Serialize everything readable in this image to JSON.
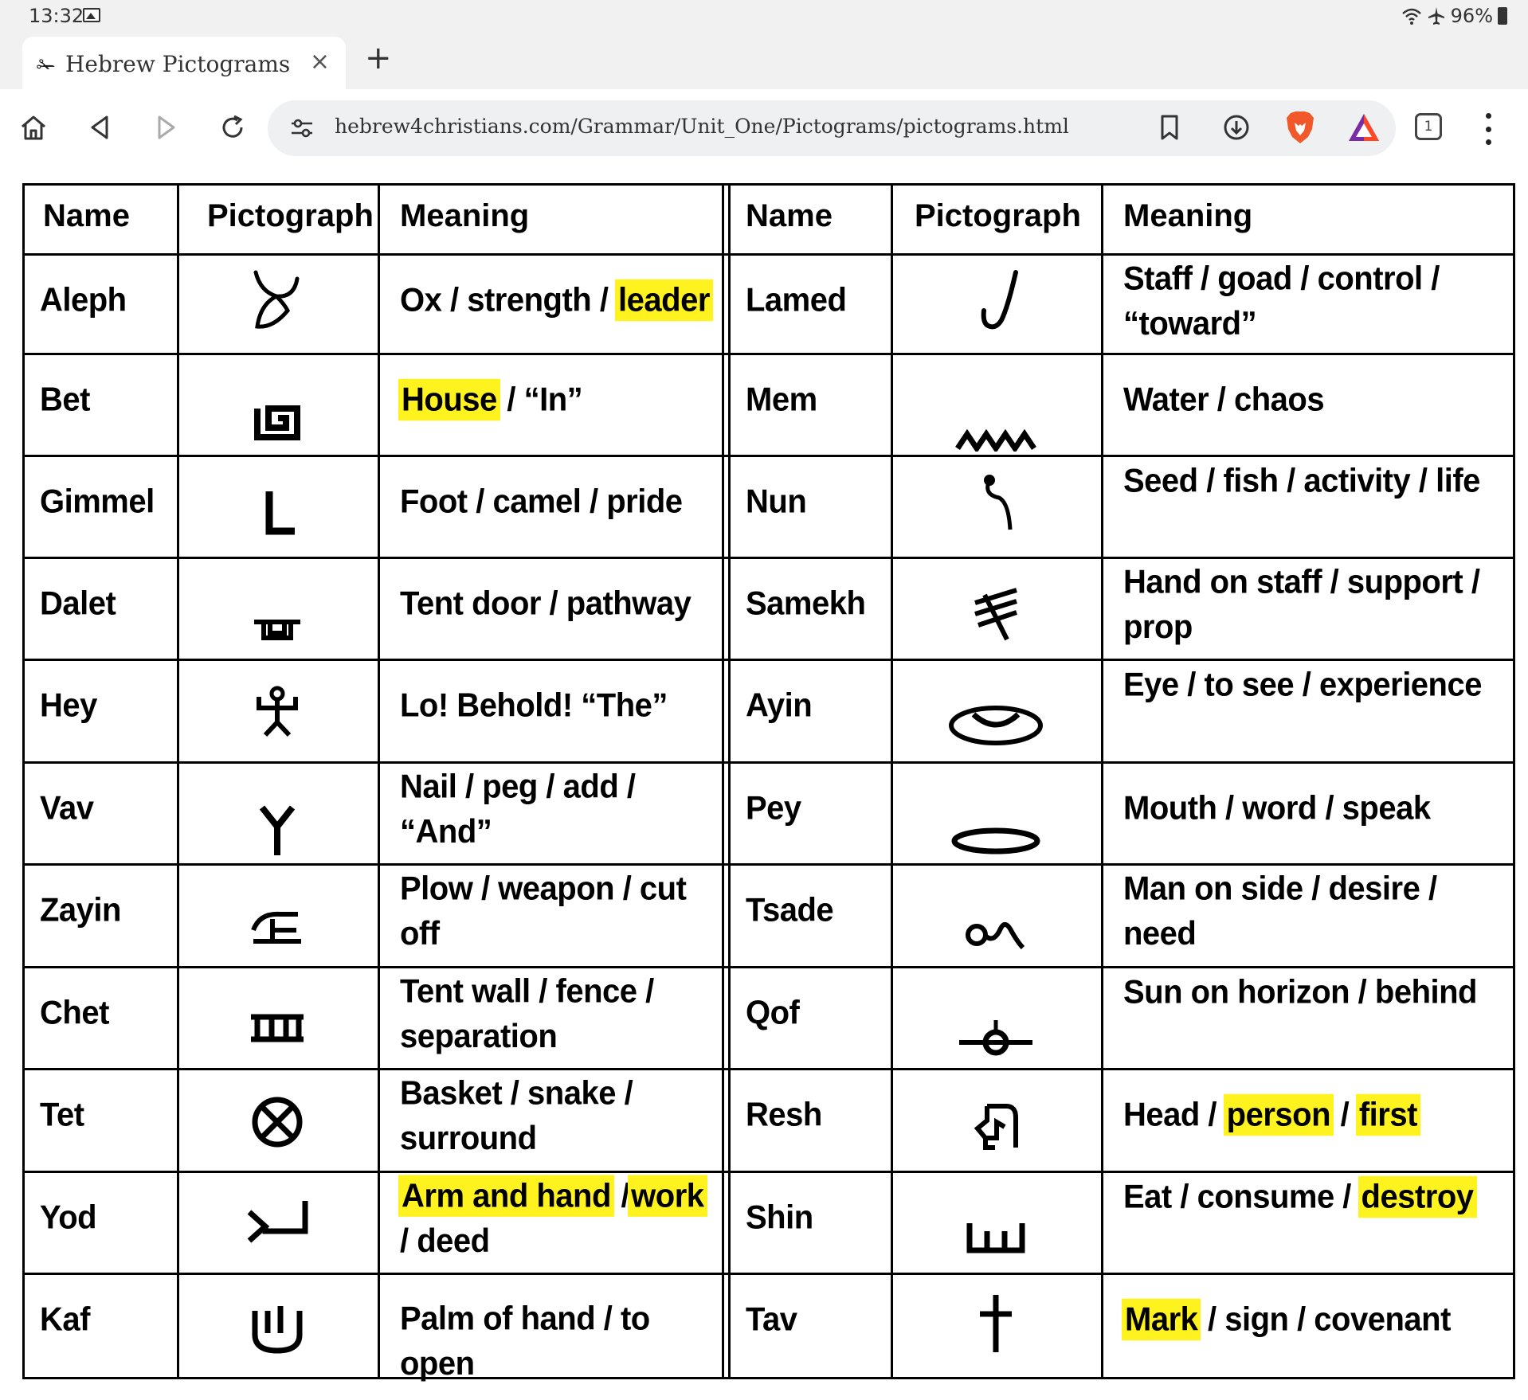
{
  "status_bar": {
    "time": "13:32",
    "battery": "96%",
    "image_icon": "image-icon",
    "wifi_icon": "wifi-icon",
    "airplane_icon": "airplane-icon"
  },
  "tab": {
    "title": "Hebrew Pictograms",
    "favicon": "hebrew-favicon-icon",
    "close_label": "×",
    "new_tab_label": "+"
  },
  "toolbar": {
    "url": "hebrew4christians.com/Grammar/Unit_One/Pictograms/pictograms.html",
    "tab_count": "1",
    "icons": [
      "home-icon",
      "back-icon",
      "forward-icon",
      "reload-icon",
      "site-settings-icon",
      "bookmark-icon",
      "download-icon",
      "brave-lion-icon",
      "brave-rewards-icon",
      "tab-count-icon",
      "menu-icon"
    ]
  },
  "table": {
    "headers": [
      "Name",
      "Pictograph",
      "Meaning"
    ],
    "highlight_color": "#fff31f",
    "left": [
      {
        "name": "Aleph",
        "meaning": [
          {
            "t": "Ox / strength / "
          },
          {
            "t": "leader",
            "hl": true
          }
        ],
        "icon": "ox-head-icon"
      },
      {
        "name": "Bet",
        "meaning": [
          {
            "t": "House",
            "hl": true
          },
          {
            "t": " / “In”"
          }
        ],
        "icon": "house-icon"
      },
      {
        "name": "Gimmel",
        "meaning": [
          {
            "t": "Foot / camel / pride"
          }
        ],
        "icon": "foot-icon"
      },
      {
        "name": "Dalet",
        "meaning": [
          {
            "t": "Tent door / pathway"
          }
        ],
        "icon": "tent-door-icon"
      },
      {
        "name": "Hey",
        "meaning": [
          {
            "t": "Lo!  Behold! “The”"
          }
        ],
        "icon": "man-arms-raised-icon"
      },
      {
        "name": "Vav",
        "meaning": [
          {
            "t": "Nail / peg / add / “And”"
          }
        ],
        "icon": "nail-icon"
      },
      {
        "name": "Zayin",
        "meaning": [
          {
            "t": "Plow / weapon / cut off"
          }
        ],
        "icon": "plow-icon"
      },
      {
        "name": "Chet",
        "meaning": [
          {
            "t": "Tent wall / fence / separation"
          }
        ],
        "icon": "fence-icon"
      },
      {
        "name": "Tet",
        "meaning": [
          {
            "t": "Basket / snake / surround"
          }
        ],
        "icon": "basket-icon"
      },
      {
        "name": "Yod",
        "meaning": [
          {
            "t": "Arm and hand",
            "hl": true
          },
          {
            "t": " /"
          },
          {
            "t": "work",
            "hl": true
          },
          {
            "t": " / deed"
          }
        ],
        "icon": "arm-hand-icon"
      },
      {
        "name": "Kaf",
        "meaning": [
          {
            "t": "Palm of hand / to open"
          }
        ],
        "icon": "palm-icon"
      }
    ],
    "right": [
      {
        "name": "Lamed",
        "meaning": [
          {
            "t": "Staff / goad / control / “toward”"
          }
        ],
        "icon": "staff-icon"
      },
      {
        "name": "Mem",
        "meaning": [
          {
            "t": "Water / chaos"
          }
        ],
        "icon": "water-icon"
      },
      {
        "name": "Nun",
        "meaning": [
          {
            "t": "Seed / fish / activity / life"
          }
        ],
        "icon": "seed-icon"
      },
      {
        "name": "Samekh",
        "meaning": [
          {
            "t": "Hand on staff / support / prop"
          }
        ],
        "icon": "thorn-icon"
      },
      {
        "name": "Ayin",
        "meaning": [
          {
            "t": "Eye / to see / experience"
          }
        ],
        "icon": "eye-icon"
      },
      {
        "name": "Pey",
        "meaning": [
          {
            "t": "Mouth / word / speak"
          }
        ],
        "icon": "mouth-icon"
      },
      {
        "name": "Tsade",
        "meaning": [
          {
            "t": "Man on side / desire / need"
          }
        ],
        "icon": "man-on-side-icon"
      },
      {
        "name": "Qof",
        "meaning": [
          {
            "t": "Sun on horizon / behind"
          }
        ],
        "icon": "sun-horizon-icon"
      },
      {
        "name": "Resh",
        "meaning": [
          {
            "t": "Head / "
          },
          {
            "t": "person",
            "hl": true
          },
          {
            "t": " / "
          },
          {
            "t": "first",
            "hl": true
          }
        ],
        "icon": "head-icon"
      },
      {
        "name": "Shin",
        "meaning": [
          {
            "t": "Eat / consume / "
          },
          {
            "t": "destroy",
            "hl": true
          }
        ],
        "icon": "teeth-icon"
      },
      {
        "name": "Tav",
        "meaning": [
          {
            "t": "Mark",
            "hl": true
          },
          {
            "t": " / sign / covenant"
          }
        ],
        "icon": "cross-mark-icon"
      }
    ]
  }
}
